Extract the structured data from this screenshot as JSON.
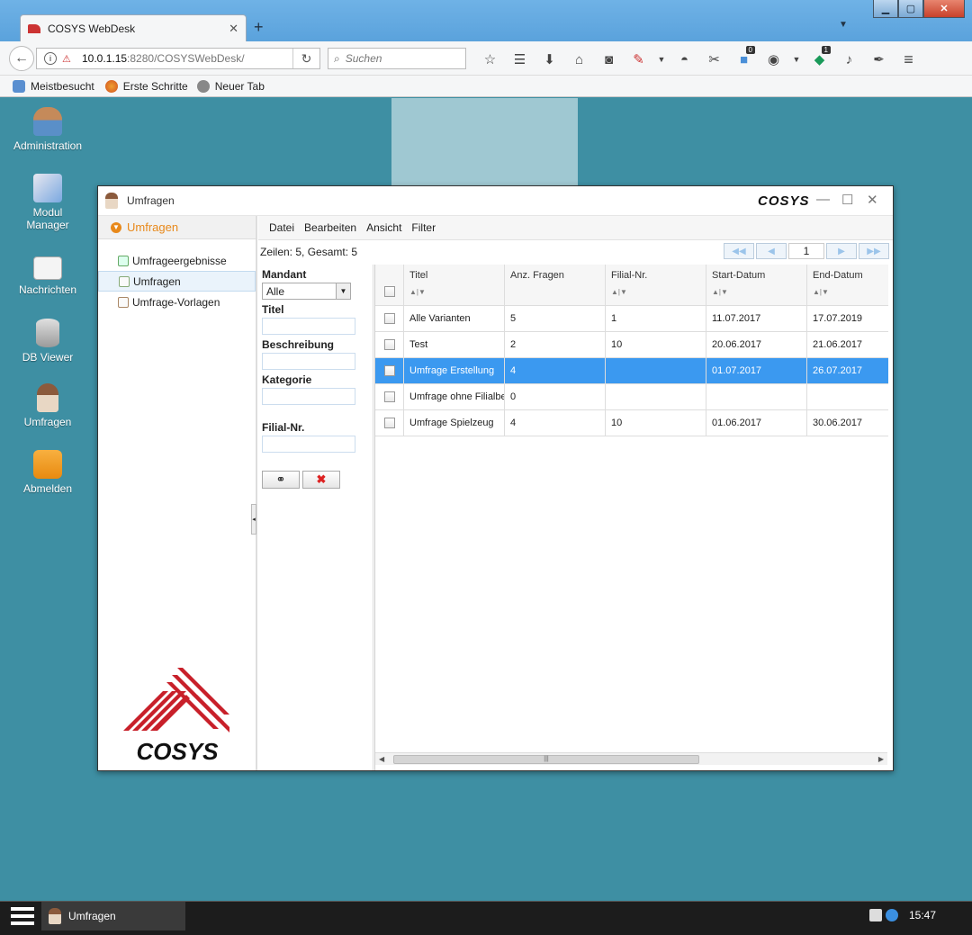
{
  "browser": {
    "tab_title": "COSYS WebDesk",
    "new_tab_symbol": "+",
    "url_host": "10.0.1.15",
    "url_rest": ":8280/COSYSWebDesk/",
    "search_placeholder": "Suchen",
    "toolbar_badges": {
      "notifications": "0",
      "extension": "1"
    },
    "bookmarks": [
      "Meistbesucht",
      "Erste Schritte",
      "Neuer Tab"
    ]
  },
  "desktop": {
    "icons": [
      {
        "label": "Administration",
        "icon": "admin-icon"
      },
      {
        "label": "Modul\nManager",
        "icon": "module-manager-icon"
      },
      {
        "label": "Nachrichten",
        "icon": "mail-icon"
      },
      {
        "label": "DB Viewer",
        "icon": "database-icon"
      },
      {
        "label": "Umfragen",
        "icon": "survey-person-icon"
      },
      {
        "label": "Abmelden",
        "icon": "lock-icon"
      }
    ]
  },
  "app_window": {
    "title": "Umfragen",
    "logo_text": "COSYS",
    "sidebar": {
      "header": "Umfragen",
      "items": [
        "Umfrageergebnisse",
        "Umfragen",
        "Umfrage-Vorlagen"
      ],
      "active_index": 1
    },
    "menu": [
      "Datei",
      "Bearbeiten",
      "Ansicht",
      "Filter"
    ],
    "rows_info": "Zeilen: 5, Gesamt: 5",
    "page_number": "1",
    "filter": {
      "mandant_label": "Mandant",
      "mandant_value": "Alle",
      "titel_label": "Titel",
      "beschreibung_label": "Beschreibung",
      "kategorie_label": "Kategorie",
      "filial_label": "Filial-Nr."
    },
    "table": {
      "columns": [
        "Titel",
        "Anz. Fragen",
        "Filial-Nr.",
        "Start-Datum",
        "End-Datum"
      ],
      "rows": [
        {
          "titel": "Alle Varianten",
          "anz": "5",
          "filial": "1",
          "start": "11.07.2017",
          "end": "17.07.2019"
        },
        {
          "titel": "Test",
          "anz": "2",
          "filial": "10",
          "start": "20.06.2017",
          "end": "21.06.2017"
        },
        {
          "titel": "Umfrage Erstellung",
          "anz": "4",
          "filial": "",
          "start": "01.07.2017",
          "end": "26.07.2017"
        },
        {
          "titel": "Umfrage ohne Filialbe:",
          "anz": "0",
          "filial": "",
          "start": "",
          "end": ""
        },
        {
          "titel": "Umfrage Spielzeug",
          "anz": "4",
          "filial": "10",
          "start": "01.06.2017",
          "end": "30.06.2017"
        }
      ],
      "selected_index": 2
    }
  },
  "taskbar": {
    "task_label": "Umfragen",
    "clock": "15:47"
  },
  "colors": {
    "desktop": "#3e8fa3",
    "selection": "#3b99f0",
    "accent_orange": "#e8891b",
    "logo_red": "#c8202a"
  }
}
